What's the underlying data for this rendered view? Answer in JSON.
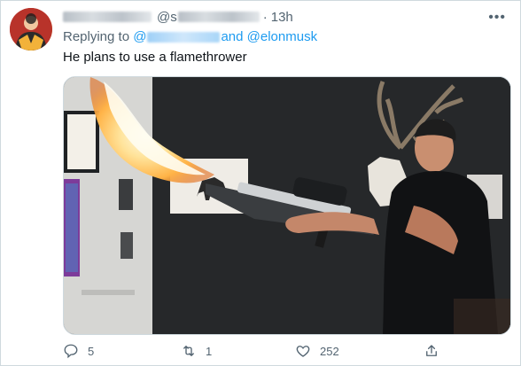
{
  "tweet": {
    "author_handle_prefix": "@",
    "handle_fragment": "s",
    "separator": "·",
    "time": "13h",
    "more_label": "•••",
    "replying_to_label": "Replying to",
    "replying_first_prefix": "@",
    "replying_and": "and",
    "replying_second": "@elonmusk",
    "text": "He plans to use a flamethrower",
    "media_description_icon": "photo"
  },
  "actions": {
    "reply_count": "5",
    "retweet_count": "1",
    "like_count": "252"
  },
  "colors": {
    "link": "#1d9bf0",
    "muted": "#536471",
    "text": "#0f1419",
    "border": "#cfd9de"
  }
}
